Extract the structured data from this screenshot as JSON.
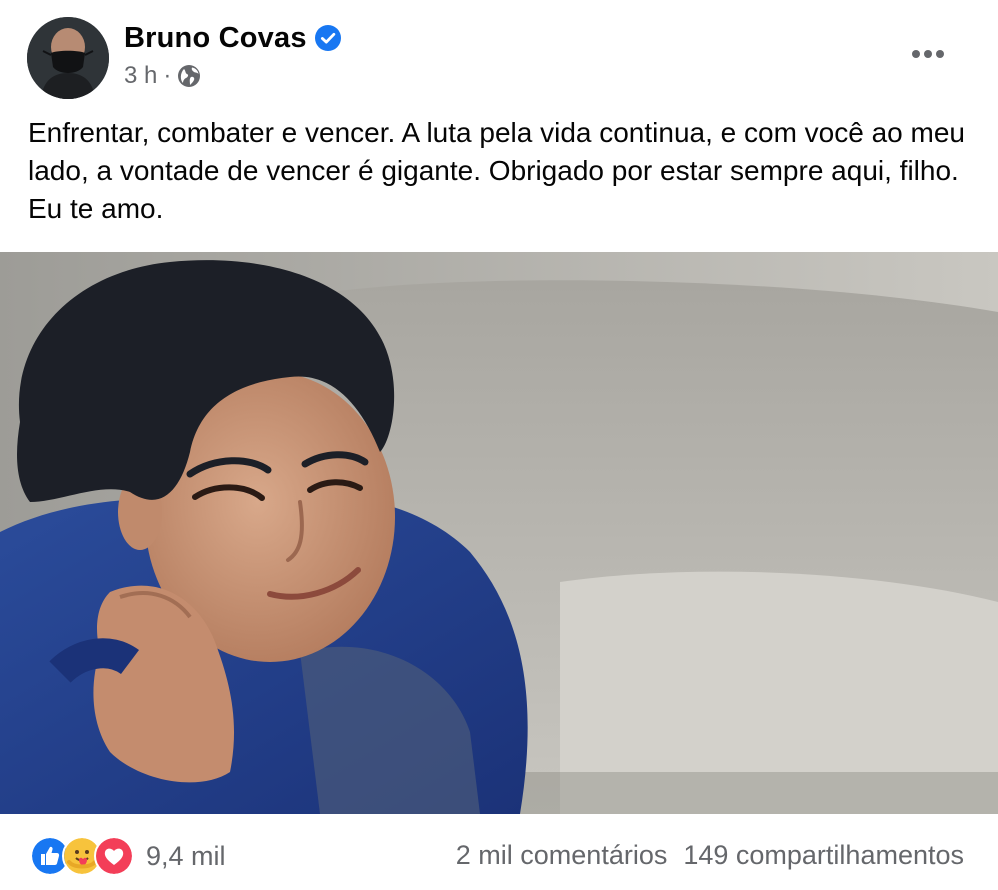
{
  "post": {
    "author": "Bruno Covas",
    "timestamp": "3 h",
    "separator": "·",
    "visibility_icon": "globe-icon",
    "verified_icon": "verified-badge-icon",
    "more_icon": "more-options-icon",
    "text": "Enfrentar, combater e vencer. A luta pela vida continua, e com você ao meu lado, a vontade de vencer é gigante. Obrigado por estar sempre aqui, filho. Eu te amo."
  },
  "footer": {
    "reactions": [
      "like-icon",
      "care-icon",
      "love-icon"
    ],
    "reaction_count": "9,4 mil",
    "comments": "2 mil comentários",
    "shares": "149 compartilhamentos"
  },
  "colors": {
    "facebook_blue": "#1877f2",
    "secondary_text": "#65676b",
    "primary_text": "#050505",
    "love_red": "#f33e58"
  }
}
